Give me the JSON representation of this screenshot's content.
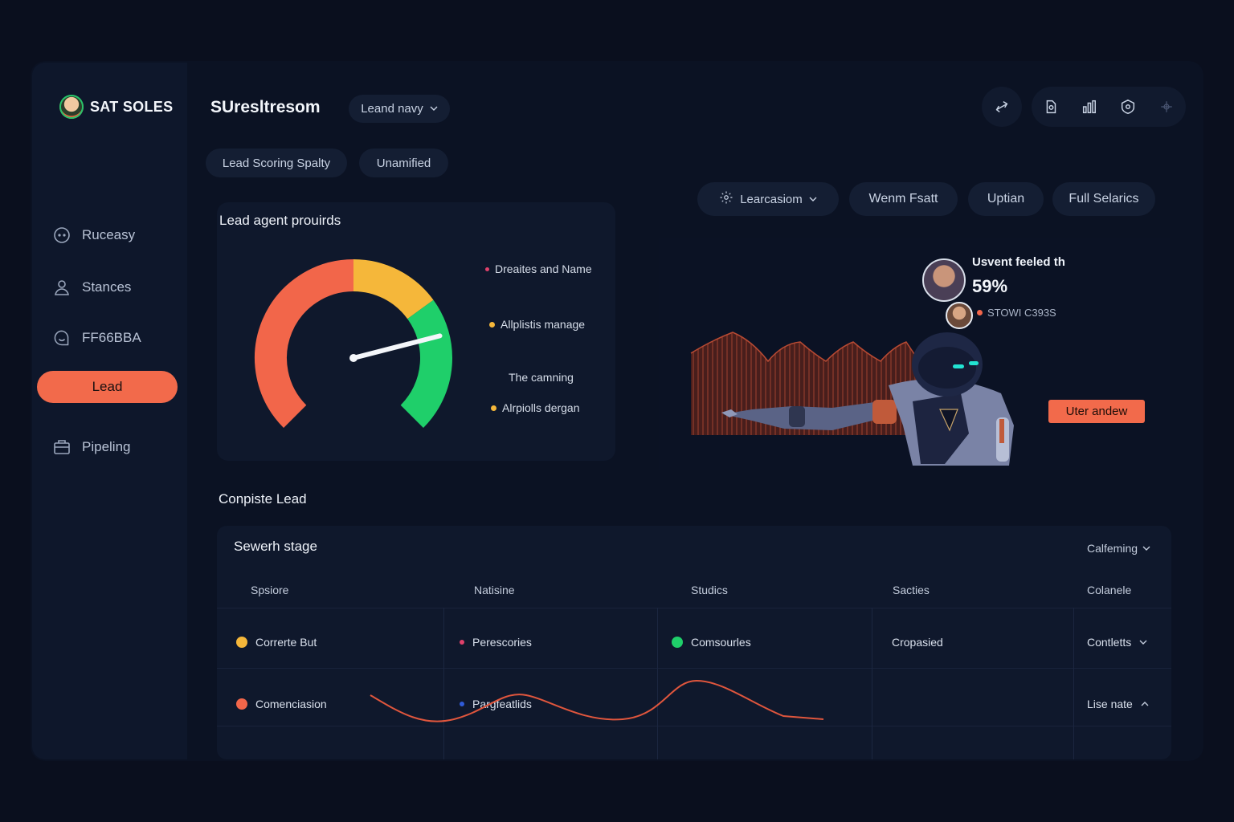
{
  "brand": {
    "name": "SAT SOLES"
  },
  "sidebar": {
    "items": [
      {
        "label": "Ruceasy",
        "icon": "chat-bubble-icon"
      },
      {
        "label": "Stances",
        "icon": "user-group-icon"
      },
      {
        "label": "FF66BBA",
        "icon": "smile-chat-icon"
      },
      {
        "label": "Lead",
        "icon": "",
        "active": true
      },
      {
        "label": "Pipeling",
        "icon": "briefcase-icon"
      }
    ]
  },
  "header": {
    "title": "SUresltresom",
    "dropdown_label": "Leand navy",
    "tabs": [
      "Lead Scoring Spalty",
      "Unamified"
    ],
    "icons": [
      "share-icon",
      "document-icon",
      "bar-chart-icon",
      "shield-icon",
      "plus-move-icon"
    ]
  },
  "filters": {
    "dropdown_label": "Learcasiom",
    "buttons": [
      "Wenm Fsatt",
      "Uptian",
      "Full Selarics"
    ]
  },
  "gauge_card": {
    "title": "Lead agent prouirds",
    "gauge_value_fraction": 0.78,
    "segments": [
      {
        "color": "#f2664a",
        "fraction": 0.5
      },
      {
        "color": "#f5b73a",
        "fraction": 0.2
      },
      {
        "color": "#1fcf6a",
        "fraction": 0.3
      }
    ],
    "legend": [
      {
        "label": "Dreaites and Name",
        "color": "#e0416b"
      },
      {
        "label": "Allplistis manage",
        "color": "#f5b73a"
      },
      {
        "label": "The camning",
        "color": ""
      },
      {
        "label": "Alrpiolls dergan",
        "color": "#f5b73a"
      }
    ]
  },
  "agent_panel": {
    "stat_label": "Usvent feeled th",
    "stat_value": "59%",
    "sub_label": "STOWI C393S",
    "sub_color": "#f2664a",
    "cta": "Uter andew"
  },
  "table": {
    "section_title": "Conpiste Lead",
    "card_title": "Sewerh stage",
    "sort_label": "Calfeming",
    "columns": [
      "Spsiore",
      "Natisine",
      "Studics",
      "Sacties",
      "Colanele"
    ],
    "rows": [
      {
        "c1": {
          "text": "Correrte But",
          "dot": "#f5b73a"
        },
        "c2": {
          "text": "Perescories",
          "dot": "#e0416b"
        },
        "c3": {
          "text": "Comsourles",
          "dot": "#1fcf6a"
        },
        "c4": {
          "text": "Cropasied"
        },
        "c5": {
          "text": "Contletts",
          "chevron": "down"
        }
      },
      {
        "c1": {
          "text": "Comenciasion",
          "dot": "#f2664a"
        },
        "c2": {
          "text": "Pargfeatlids",
          "dot": "#2f5bd8"
        },
        "c3": {
          "text": ""
        },
        "c4": {
          "text": ""
        },
        "c5": {
          "text": "Lise nate",
          "chevron": "up"
        }
      }
    ]
  },
  "colors": {
    "background": "#0a0f1e",
    "panel": "#0f182c",
    "accent": "#f26a4b",
    "green": "#1fcf6a",
    "amber": "#f5b73a"
  }
}
